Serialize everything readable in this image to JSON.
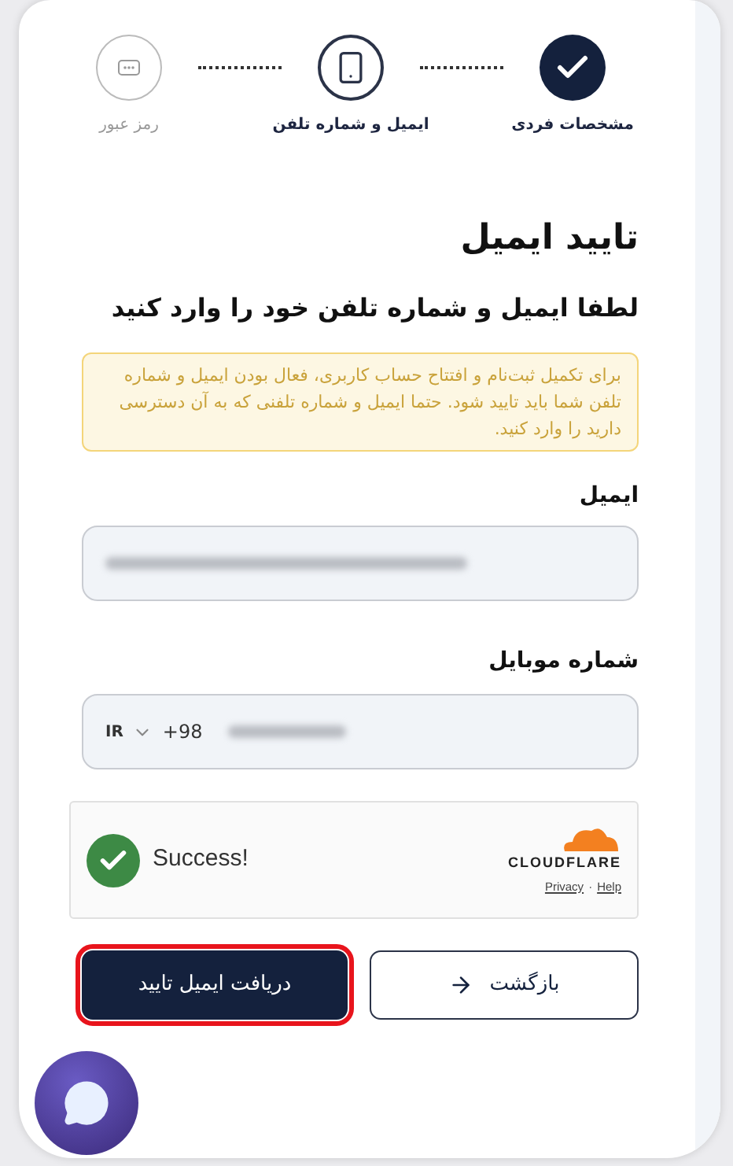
{
  "stepper": [
    {
      "label": "مشخصات فردی",
      "kind": "done"
    },
    {
      "label": "ایمیل و شماره تلفن",
      "kind": "current"
    },
    {
      "label": "رمز عبور",
      "kind": "upcoming"
    }
  ],
  "title": "تایید ایمیل",
  "subtitle": "لطفا ایمیل و شماره تلفن خود را وارد کنید",
  "alert": "برای تکمیل ثبت‌نام و افتتاح حساب کاربری، فعال بودن ایمیل و شماره تلفن شما باید تایید شود. حتما ایمیل و شماره تلفنی که به آن دسترسی دارید را وارد کنید.",
  "email": {
    "label": "ایمیل",
    "redacted": true
  },
  "phone": {
    "label": "شماره موبایل",
    "country": "IR",
    "code": "+98",
    "redacted": true
  },
  "captcha": {
    "status": "Success!",
    "passed": true,
    "brand": "CLOUDFLARE",
    "privacy_link": "Privacy",
    "separator": "·",
    "help_link": "Help"
  },
  "buttons": [
    {
      "label": "بازگشت",
      "kind": "secondary",
      "highlighted": false
    },
    {
      "label": "دریافت ایمیل تایید",
      "kind": "primary",
      "highlighted": true
    }
  ]
}
